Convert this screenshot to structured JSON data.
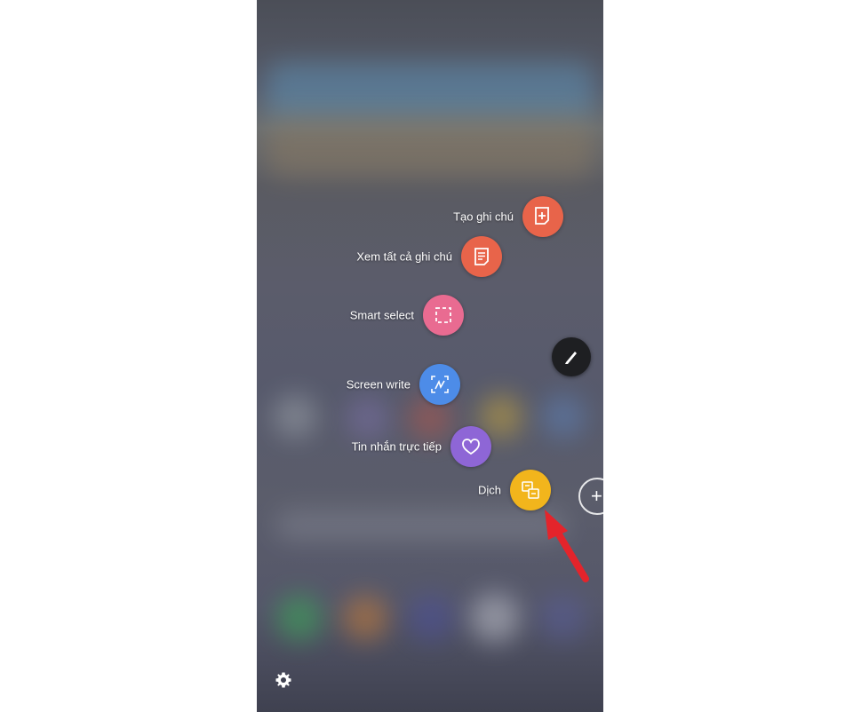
{
  "air_command": {
    "items": [
      {
        "label": "Tạo ghi chú",
        "icon": "create-note-icon",
        "color": "#e8644a"
      },
      {
        "label": "Xem tất cả ghi chú",
        "icon": "view-notes-icon",
        "color": "#e8644a"
      },
      {
        "label": "Smart select",
        "icon": "smart-select-icon",
        "color": "#e96b91"
      },
      {
        "label": "Screen write",
        "icon": "screen-write-icon",
        "color": "#4d8ce8"
      },
      {
        "label": "Tin nhắn trực tiếp",
        "icon": "live-message-icon",
        "color": "#8e66d6"
      },
      {
        "label": "Dịch",
        "icon": "translate-icon",
        "color": "#f2b51c"
      }
    ],
    "pen_button": {
      "icon": "pen-icon",
      "color": "#1e1f22"
    },
    "add_button": {
      "label": "+",
      "icon": "add-icon"
    },
    "settings": {
      "icon": "gear-icon"
    }
  },
  "annotation": {
    "icon": "red-arrow-icon",
    "color": "#e4242b"
  }
}
